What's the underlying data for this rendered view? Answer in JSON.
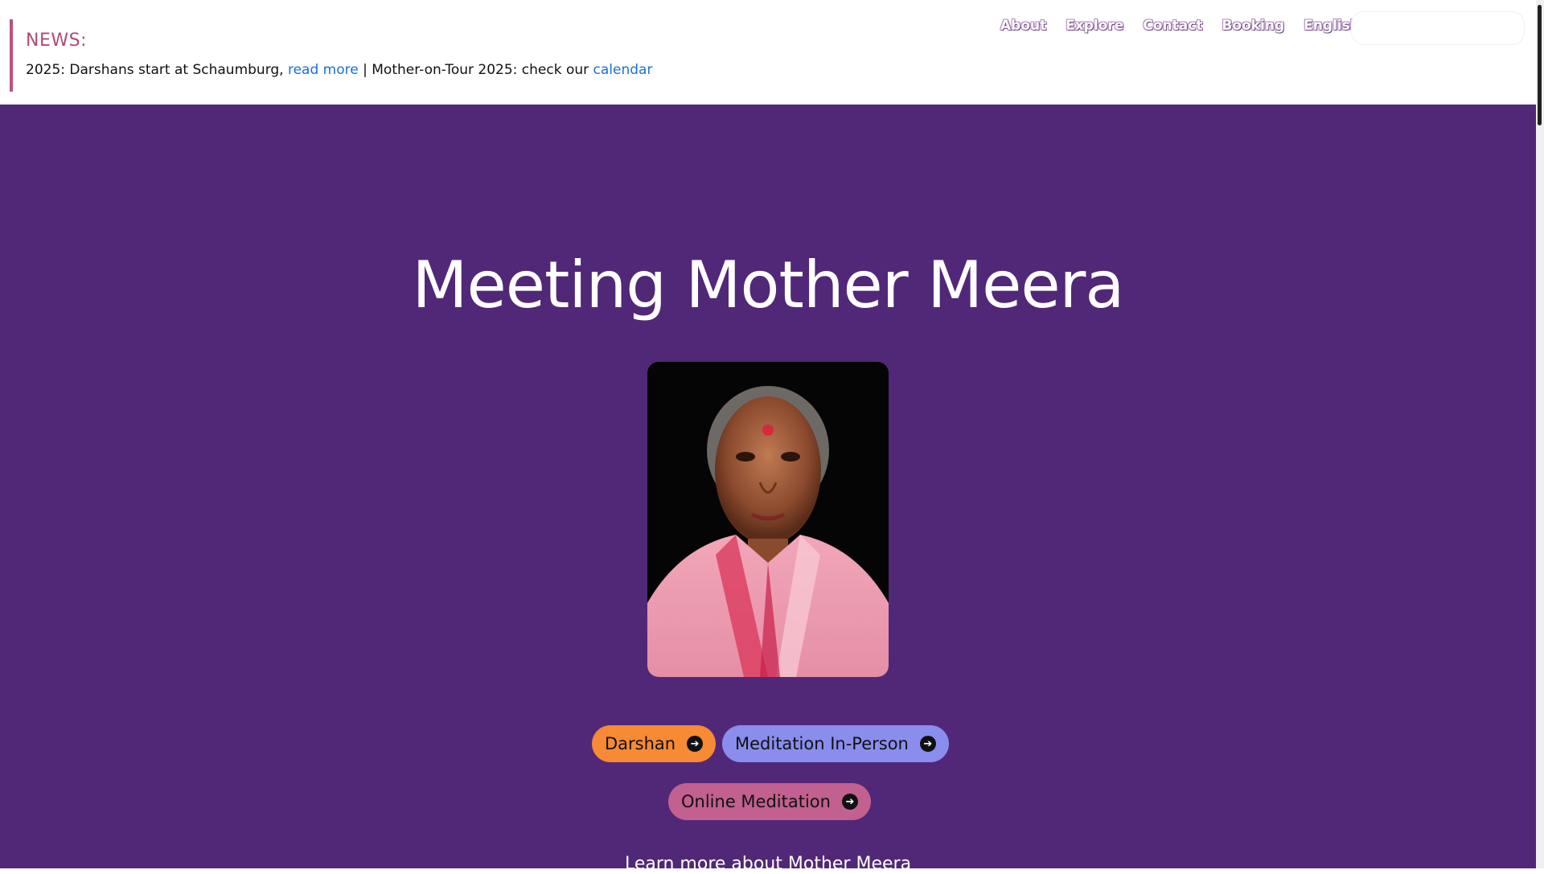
{
  "news": {
    "label": "NEWS:",
    "text_part1": "2025: Darshans start at Schaumburg, ",
    "link1": "read more",
    "text_part2": " | Mother-on-Tour 2025: check our ",
    "link2": "calendar"
  },
  "nav": {
    "items": [
      "About",
      "Explore",
      "Contact",
      "Booking",
      "English"
    ]
  },
  "hero": {
    "title": "Meeting Mother Meera",
    "buttons": {
      "darshan": "Darshan",
      "in_person": "Meditation In-Person",
      "online": "Online Meditation"
    },
    "learn_more": "Learn more about Mother Meera"
  },
  "colors": {
    "hero_bg": "#512877",
    "darshan": "#f68a35",
    "in_person": "#8a8ded",
    "online": "#c2608f",
    "news_accent": "#c0507c",
    "link": "#1a6fd6"
  },
  "icons": {
    "button_arrow": "arrow-circle-right-icon"
  }
}
